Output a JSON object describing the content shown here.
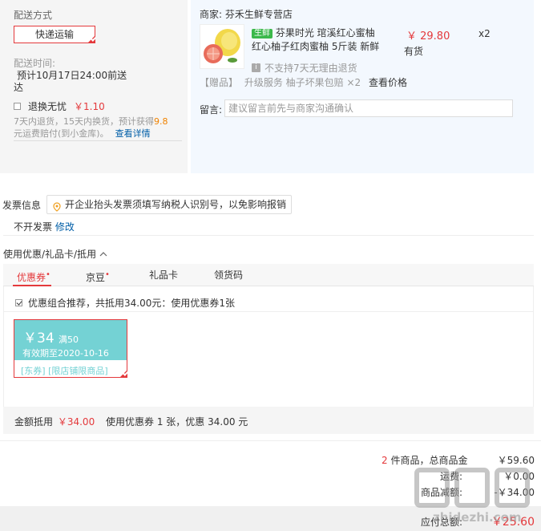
{
  "shipping": {
    "title": "配送方式",
    "method": "快递运输",
    "time_label": "配送时间:",
    "time_value_1": "预计10月17日24:00前送",
    "time_value_2": "达",
    "return_label": "退换无忧",
    "return_price": "￥1.10",
    "return_desc_1a": "7天内退货，15天内换货，预计获得",
    "return_desc_1b": "9.8",
    "return_desc_2": "元运费赔付(到小金库)。",
    "details_link": "查看详情"
  },
  "merchant": {
    "label": "商家:",
    "name": "芬禾生鲜专营店"
  },
  "product": {
    "tag": "生鲜",
    "title_1": "芬果时光 琯溪红心蜜柚",
    "title_2": "红心柚子红肉蜜柚 5斤装 新鲜",
    "price": "￥ 29.80",
    "qty": "x2",
    "stock": "有货",
    "no_return": "不支持7天无理由退货",
    "gift_tag": "【赠品】",
    "gift_name": "升级服务 柚子坏果包赔",
    "gift_qty": "×2",
    "gift_link": "查看价格"
  },
  "message": {
    "label": "留言:",
    "placeholder": "建议留言前先与商家沟通确认"
  },
  "invoice": {
    "title": "发票信息",
    "tip": "开企业抬头发票须填写纳税人识别号，以免影响报销",
    "value": "不开发票",
    "edit": "修改"
  },
  "discount": {
    "title": "使用优惠/礼品卡/抵用",
    "tabs": [
      {
        "label": "优惠券",
        "dot": "•"
      },
      {
        "label": "京豆",
        "dot": "•"
      },
      {
        "label": "礼品卡",
        "dot": ""
      },
      {
        "label": "领货码",
        "dot": ""
      }
    ],
    "recommend": "优惠组合推荐，共抵用34.00元：使用优惠券1张",
    "coupon": {
      "amount": "￥34",
      "condition": "满50",
      "validity": "有效期至2020-10-16",
      "type": "[东券] [限店铺限商品]"
    },
    "summary_label": "金额抵用",
    "summary_amount": "￥34.00",
    "summary_text": "使用优惠券 1 张，优惠 34.00 元"
  },
  "totals": {
    "count": "2",
    "goods_label": "件商品，总商品金",
    "goods_value": "￥59.60",
    "freight_label": "运费:",
    "freight_value": "￥0.00",
    "discount_label": "商品减额:",
    "discount_value": "-￥34.00",
    "payable_label": "应付总额:",
    "payable_value": "￥25.60"
  },
  "watermark": "zhidezhi.com",
  "colors": {
    "accent": "#e4393c",
    "link": "#005ea7",
    "coupon": "#74d2d4",
    "fresh": "#3bb84a"
  }
}
